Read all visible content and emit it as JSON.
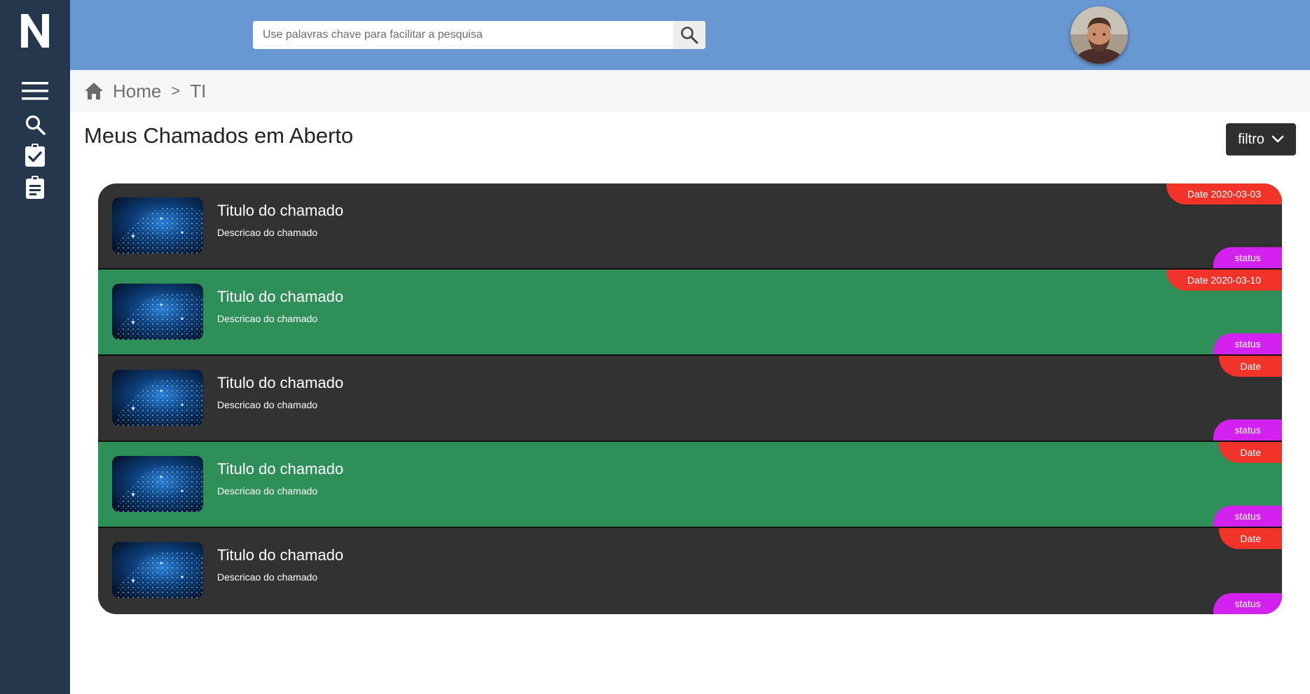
{
  "app": {
    "logo_letter": "N"
  },
  "colors": {
    "sidebar": "#25374d",
    "topbar": "#6898d2",
    "ticket_dark": "#323232",
    "ticket_green": "#2e8f58",
    "date_badge": "#f1332a",
    "status_badge": "#d321f0"
  },
  "sidebar": {
    "items": [
      {
        "icon": "menu-icon"
      },
      {
        "icon": "search-icon"
      },
      {
        "icon": "clipboard-check-icon"
      },
      {
        "icon": "clipboard-list-icon"
      }
    ]
  },
  "search": {
    "placeholder": "Use palavras chave para facilitar a pesquisa",
    "value": ""
  },
  "breadcrumb": {
    "items": [
      "Home",
      "TI"
    ],
    "separator": ">"
  },
  "page": {
    "title": "Meus Chamados em Aberto",
    "filter_label": "filtro"
  },
  "tickets": [
    {
      "title": "Titulo do chamado",
      "description": "Descricao do chamado",
      "date": "Date 2020-03-03",
      "status": "status",
      "theme": "dark"
    },
    {
      "title": "Titulo do chamado",
      "description": "Descricao do chamado",
      "date": "Date 2020-03-10",
      "status": "status",
      "theme": "green"
    },
    {
      "title": "Titulo do chamado",
      "description": "Descricao do chamado",
      "date": "Date",
      "status": "status",
      "theme": "dark"
    },
    {
      "title": "Titulo do chamado",
      "description": "Descricao do chamado",
      "date": "Date",
      "status": "status",
      "theme": "green"
    },
    {
      "title": "Titulo do chamado",
      "description": "Descricao do chamado",
      "date": "Date",
      "status": "status",
      "theme": "dark"
    }
  ]
}
